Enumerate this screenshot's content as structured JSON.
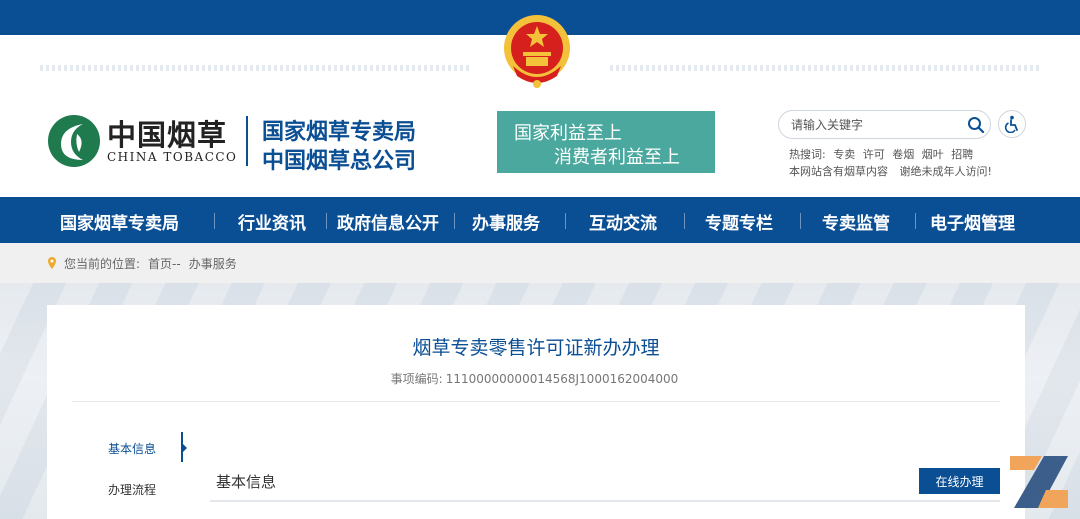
{
  "header": {
    "logo_cn": "中国烟草",
    "logo_en": "CHINA TOBACCO",
    "org_line1": "国家烟草专卖局",
    "org_line2": "中国烟草总公司",
    "slogan_line1": "国家利益至上",
    "slogan_line2": "消费者利益至上"
  },
  "search": {
    "placeholder": "请输入关键字",
    "hot_label": "热搜词:",
    "hot_words": [
      "专卖",
      "许可",
      "卷烟",
      "烟叶",
      "招聘"
    ],
    "notice_1": "本网站含有烟草内容",
    "notice_2": "谢绝未成年人访问!"
  },
  "nav": {
    "items": [
      "国家烟草专卖局",
      "行业资讯",
      "政府信息公开",
      "办事服务",
      "互动交流",
      "专题专栏",
      "专卖监管",
      "电子烟管理"
    ]
  },
  "breadcrumb": {
    "label": "您当前的位置:",
    "home": "首页--",
    "current": "办事服务"
  },
  "content": {
    "title": "烟草专卖零售许可证新办办理",
    "code_label": "事项编码:",
    "code_value": "11100000000014568J1000162004000",
    "side_items": [
      "基本信息",
      "办理流程"
    ],
    "section_title": "基本信息",
    "online_button": "在线办理"
  },
  "colors": {
    "primary": "#0a4e94",
    "slogan_bg": "#4aa89e",
    "logo_green": "#1f7a4d"
  },
  "icons": {
    "search": "search-icon",
    "accessibility": "accessibility-icon",
    "location": "location-pin-icon"
  }
}
